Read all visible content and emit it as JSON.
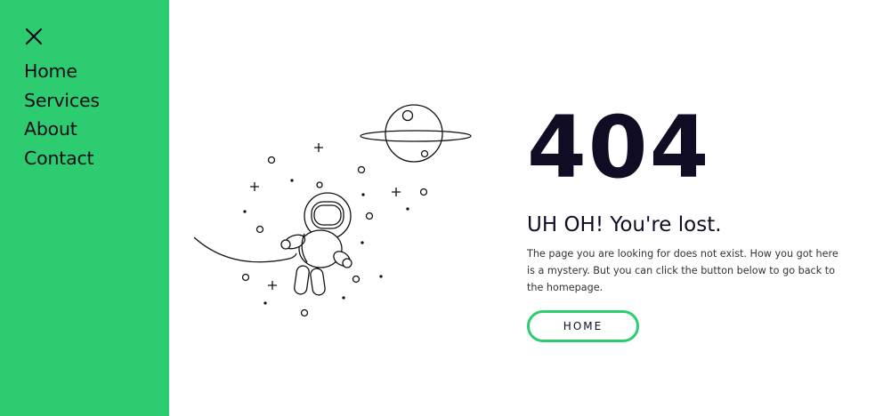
{
  "sidebar": {
    "bg_color": "#2ecc71",
    "close_icon": "close-icon",
    "nav_items": [
      {
        "label": "Home"
      },
      {
        "label": "Services"
      },
      {
        "label": "About"
      },
      {
        "label": "Contact"
      }
    ]
  },
  "main": {
    "error_code": "404",
    "heading": "UH OH! You're lost.",
    "description": "The page you are looking for does not exist. How you got here is a mystery. But you can click the button below to go back to the homepage.",
    "home_button": "HOME",
    "accent_color": "#2ecc71",
    "text_color": "#0f0c24",
    "illustration_icon": "astronaut-planet-illustration"
  }
}
